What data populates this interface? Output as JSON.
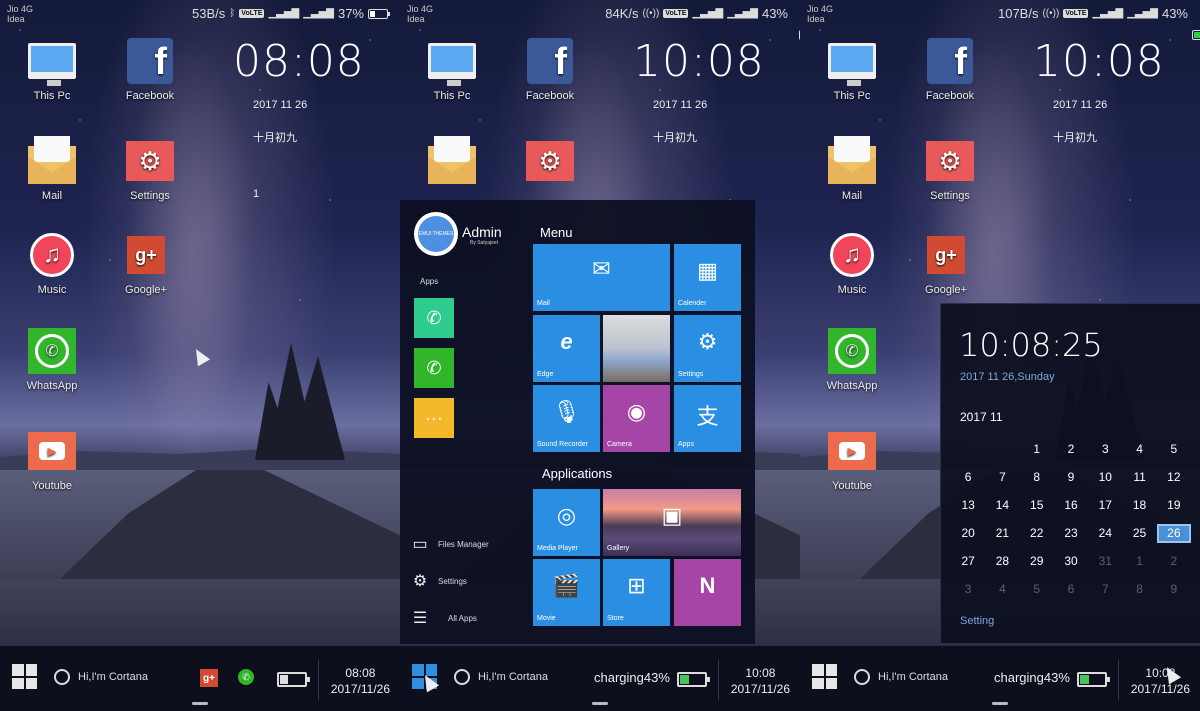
{
  "screens": [
    {
      "status": {
        "carrier1": "Jio 4G",
        "carrier2": "Idea",
        "speed": "53B/s",
        "volte": "VoLTE",
        "battery": "37%",
        "battery_level": 0.37,
        "charging": false
      },
      "desktop_icons": [
        {
          "label": "This Pc",
          "icon": "computer-icon"
        },
        {
          "label": "Facebook",
          "icon": "facebook-icon",
          "glyph": "f"
        },
        {
          "label": "Mail",
          "icon": "mail-icon"
        },
        {
          "label": "Settings",
          "icon": "settings-icon",
          "glyph": "⚙"
        },
        {
          "label": "Music",
          "icon": "music-icon",
          "glyph": "♫"
        },
        {
          "label": "Google+",
          "icon": "google-plus-icon",
          "glyph": "g+"
        },
        {
          "label": "WhatsApp",
          "icon": "whatsapp-icon",
          "glyph": "✆"
        },
        {
          "label": "Youtube",
          "icon": "youtube-icon",
          "glyph": "▶"
        }
      ],
      "clock": "08:08",
      "date": "2017 11 26",
      "lunar": "十月初九",
      "badge": "1",
      "taskbar": {
        "cortana": "Hi,I'm Cortana",
        "google_glyph": "g+",
        "whatsapp_glyph": "✆",
        "battery_level": 0.37,
        "time": "08:08",
        "date": "2017/11/26"
      }
    },
    {
      "status": {
        "carrier1": "Jio 4G",
        "carrier2": "Idea",
        "speed": "84K/s",
        "volte": "VoLTE",
        "hotspot": "2",
        "battery": "43%",
        "battery_level": 0.43,
        "charging": true
      },
      "desktop_icons": [
        {
          "label": "This Pc"
        },
        {
          "label": "Facebook",
          "glyph": "f"
        },
        {
          "label": "Mail"
        },
        {
          "label": "Settings",
          "glyph": "⚙"
        }
      ],
      "clock": "10:08",
      "date": "2017 11 26",
      "lunar": "十月初九",
      "start_menu": {
        "user": "Admin",
        "user_sub": "By Satyajeet",
        "avatar_text": "EMUI THEMES",
        "apps_label": "Apps",
        "pinned": [
          {
            "icon": "phone-icon",
            "glyph": "✆",
            "color": "#2ecc8f"
          },
          {
            "icon": "whatsapp-icon",
            "glyph": "✆",
            "color": "#31b52a"
          },
          {
            "icon": "message-icon",
            "glyph": "···",
            "color": "#f3b92b"
          }
        ],
        "links": [
          {
            "label": "Files Manager",
            "glyph": "▭"
          },
          {
            "label": "Settings",
            "glyph": "⚙"
          },
          {
            "label": "All Apps",
            "glyph": "☰"
          }
        ],
        "menu_title": "Menu",
        "menu_tiles": [
          {
            "label": "Mail",
            "glyph": "✉"
          },
          {
            "label": "Calender",
            "glyph": "▦"
          },
          {
            "label": "Edge",
            "glyph": "e"
          },
          {
            "label": "",
            "glyph": ""
          },
          {
            "label": "Settings",
            "glyph": "⚙"
          },
          {
            "label": "Sound Recorder",
            "glyph": "🎙"
          },
          {
            "label": "Camera",
            "glyph": "◉"
          },
          {
            "label": "Apps",
            "glyph": "支"
          }
        ],
        "apps_title": "Applications",
        "app_tiles": [
          {
            "label": "Media Player",
            "glyph": "◎"
          },
          {
            "label": "Gallery",
            "glyph": "▣"
          },
          {
            "label": "Movie",
            "glyph": "🎬"
          },
          {
            "label": "Store",
            "glyph": "⊞"
          },
          {
            "label": "",
            "glyph": "N"
          }
        ]
      },
      "taskbar": {
        "cortana": "Hi,I'm Cortana",
        "charging": "charging43%",
        "battery_level": 0.43,
        "time": "10:08",
        "date": "2017/11/26"
      }
    },
    {
      "status": {
        "carrier1": "Jio 4G",
        "carrier2": "Idea",
        "speed": "107B/s",
        "volte": "VoLTE",
        "hotspot": "2",
        "battery": "43%",
        "battery_level": 0.43,
        "charging": true
      },
      "desktop_icons": [
        {
          "label": "This Pc"
        },
        {
          "label": "Facebook",
          "glyph": "f"
        },
        {
          "label": "Mail"
        },
        {
          "label": "Settings",
          "glyph": "⚙"
        },
        {
          "label": "Music",
          "glyph": "♫"
        },
        {
          "label": "Google+",
          "glyph": "g+"
        },
        {
          "label": "WhatsApp",
          "glyph": "✆"
        },
        {
          "label": "Youtube",
          "glyph": "▶"
        }
      ],
      "clock": "10:08",
      "date": "2017 11 26",
      "lunar": "十月初九",
      "calendar": {
        "time": "10:08:25",
        "full_date": "2017 11 26,Sunday",
        "month": "2017 11",
        "selected_day": "26",
        "setting": "Setting",
        "days": [
          {
            "d": "",
            "s": ""
          },
          {
            "d": "",
            "s": ""
          },
          {
            "d": "1",
            "s": ""
          },
          {
            "d": "2",
            "s": ""
          },
          {
            "d": "3",
            "s": ""
          },
          {
            "d": "4",
            "s": ""
          },
          {
            "d": "5",
            "s": ""
          },
          {
            "d": "6",
            "s": ""
          },
          {
            "d": "7",
            "s": ""
          },
          {
            "d": "8",
            "s": ""
          },
          {
            "d": "9",
            "s": ""
          },
          {
            "d": "10",
            "s": ""
          },
          {
            "d": "11",
            "s": ""
          },
          {
            "d": "12",
            "s": ""
          },
          {
            "d": "13",
            "s": ""
          },
          {
            "d": "14",
            "s": ""
          },
          {
            "d": "15",
            "s": ""
          },
          {
            "d": "16",
            "s": ""
          },
          {
            "d": "17",
            "s": ""
          },
          {
            "d": "18",
            "s": ""
          },
          {
            "d": "19",
            "s": ""
          },
          {
            "d": "20",
            "s": ""
          },
          {
            "d": "21",
            "s": ""
          },
          {
            "d": "22",
            "s": ""
          },
          {
            "d": "23",
            "s": ""
          },
          {
            "d": "24",
            "s": ""
          },
          {
            "d": "25",
            "s": ""
          },
          {
            "d": "26",
            "s": "today"
          },
          {
            "d": "27",
            "s": ""
          },
          {
            "d": "28",
            "s": ""
          },
          {
            "d": "29",
            "s": ""
          },
          {
            "d": "30",
            "s": ""
          },
          {
            "d": "31",
            "s": "dim"
          },
          {
            "d": "1",
            "s": "dim"
          },
          {
            "d": "2",
            "s": "dim"
          },
          {
            "d": "3",
            "s": "dim"
          },
          {
            "d": "4",
            "s": "dim"
          },
          {
            "d": "5",
            "s": "dim"
          },
          {
            "d": "6",
            "s": "dim"
          },
          {
            "d": "7",
            "s": "dim"
          },
          {
            "d": "8",
            "s": "dim"
          },
          {
            "d": "9",
            "s": "dim"
          }
        ]
      },
      "taskbar": {
        "cortana": "Hi,I'm Cortana",
        "charging": "charging43%",
        "battery_level": 0.43,
        "time": "10:08",
        "date": "2017/11/26"
      }
    }
  ]
}
